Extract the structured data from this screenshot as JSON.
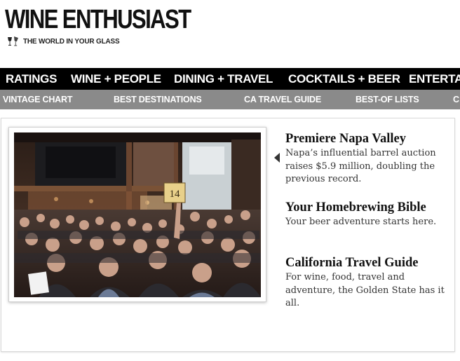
{
  "brand": {
    "name": "WINE ENTHUSIAST",
    "tagline": "THE WORLD IN YOUR GLASS"
  },
  "nav_primary": [
    "RATINGS",
    "WINE + PEOPLE",
    "DINING + TRAVEL",
    "COCKTAILS + BEER",
    "ENTERTA"
  ],
  "nav_secondary": [
    "VINTAGE CHART",
    "BEST DESTINATIONS",
    "CA TRAVEL GUIDE",
    "BEST-OF LISTS",
    "C"
  ],
  "hero": {
    "paddle_number": "14"
  },
  "stories": [
    {
      "title": "Premiere Napa Valley",
      "description": "Napa’s influential barrel auction raises $5.9 million, doubling the previous record."
    },
    {
      "title": "Your Homebrewing Bible",
      "description": "Your beer adventure starts here."
    },
    {
      "title": "California Travel Guide",
      "description": "For wine, food, travel and adventure, the Golden State has it all."
    }
  ]
}
